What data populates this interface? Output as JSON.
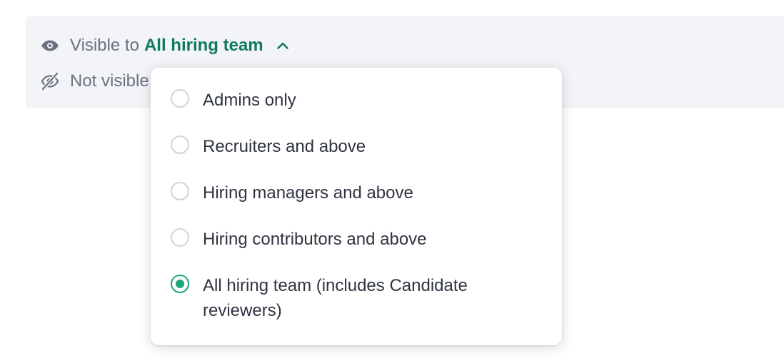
{
  "visibility": {
    "prefix": "Visible to",
    "selected_value": "All hiring team",
    "not_visible_text": "Not visible",
    "eye_icon": "eye-icon",
    "eye_off_icon": "eye-off-icon",
    "chevron_icon": "chevron-up-icon"
  },
  "dropdown": {
    "options": [
      {
        "label": "Admins only",
        "checked": false
      },
      {
        "label": "Recruiters and above",
        "checked": false
      },
      {
        "label": "Hiring managers and above",
        "checked": false
      },
      {
        "label": "Hiring contributors and above",
        "checked": false
      },
      {
        "label": "All hiring team (includes Candidate reviewers)",
        "checked": true
      }
    ]
  },
  "colors": {
    "accent": "#0f7a5d",
    "radio_checked": "#1aa774",
    "muted_text": "#6b7280",
    "panel_bg": "#f3f4f7"
  }
}
